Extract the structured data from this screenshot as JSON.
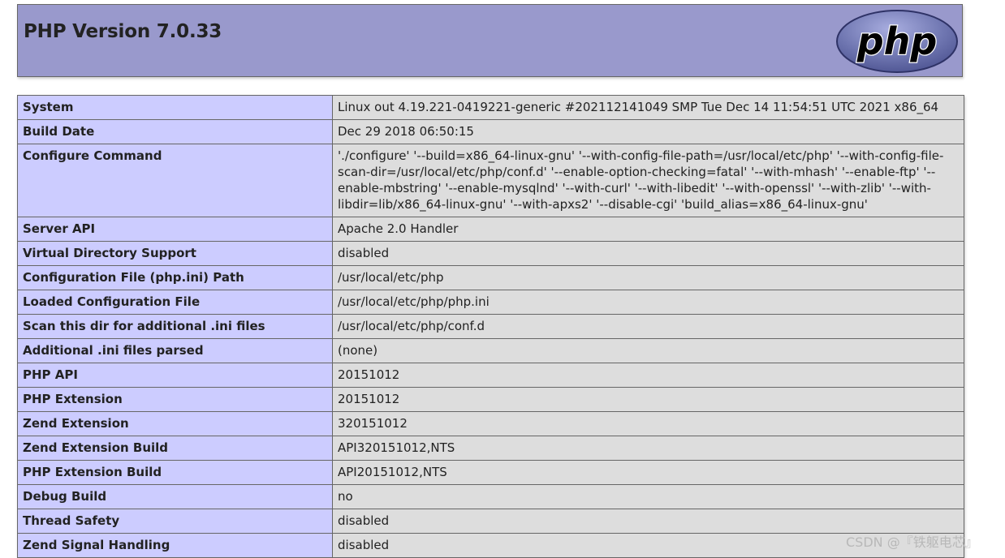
{
  "header": {
    "title": "PHP Version 7.0.33",
    "logo_text": "php"
  },
  "rows": [
    {
      "key": "System",
      "value": "Linux out 4.19.221-0419221-generic #202112141049 SMP Tue Dec 14 11:54:51 UTC 2021 x86_64"
    },
    {
      "key": "Build Date",
      "value": "Dec 29 2018 06:50:15"
    },
    {
      "key": "Configure Command",
      "value": "'./configure' '--build=x86_64-linux-gnu' '--with-config-file-path=/usr/local/etc/php' '--with-config-file-scan-dir=/usr/local/etc/php/conf.d' '--enable-option-checking=fatal' '--with-mhash' '--enable-ftp' '--enable-mbstring' '--enable-mysqlnd' '--with-curl' '--with-libedit' '--with-openssl' '--with-zlib' '--with-libdir=lib/x86_64-linux-gnu' '--with-apxs2' '--disable-cgi' 'build_alias=x86_64-linux-gnu'"
    },
    {
      "key": "Server API",
      "value": "Apache 2.0 Handler"
    },
    {
      "key": "Virtual Directory Support",
      "value": "disabled"
    },
    {
      "key": "Configuration File (php.ini) Path",
      "value": "/usr/local/etc/php"
    },
    {
      "key": "Loaded Configuration File",
      "value": "/usr/local/etc/php/php.ini"
    },
    {
      "key": "Scan this dir for additional .ini files",
      "value": "/usr/local/etc/php/conf.d"
    },
    {
      "key": "Additional .ini files parsed",
      "value": "(none)"
    },
    {
      "key": "PHP API",
      "value": "20151012"
    },
    {
      "key": "PHP Extension",
      "value": "20151012"
    },
    {
      "key": "Zend Extension",
      "value": "320151012"
    },
    {
      "key": "Zend Extension Build",
      "value": "API320151012,NTS"
    },
    {
      "key": "PHP Extension Build",
      "value": "API20151012,NTS"
    },
    {
      "key": "Debug Build",
      "value": "no"
    },
    {
      "key": "Thread Safety",
      "value": "disabled"
    },
    {
      "key": "Zend Signal Handling",
      "value": "disabled"
    }
  ],
  "watermark": "CSDN @『铁躯电芯』",
  "colors": {
    "header_bg": "#9999cc",
    "key_bg": "#ccccff",
    "value_bg": "#dddddd",
    "border": "#666666",
    "logo_bg": "#6e75b0"
  }
}
